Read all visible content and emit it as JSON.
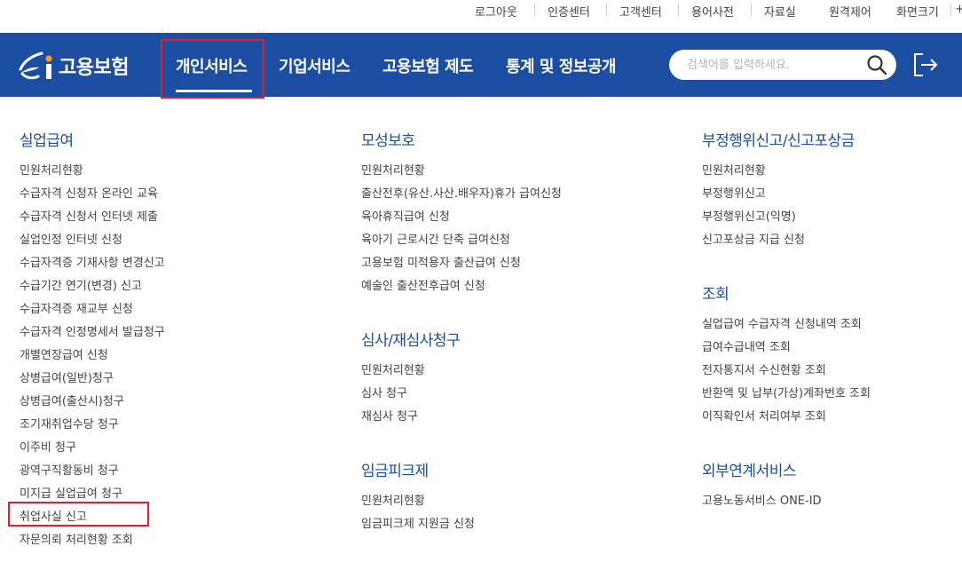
{
  "utility_links": [
    "로그아웃",
    "인증센터",
    "고객센터",
    "용어사전",
    "자료실",
    "원격제어",
    "화면크기"
  ],
  "utility_extra": "+",
  "logo": {
    "text": "고용보험"
  },
  "nav": {
    "items": [
      "개인서비스",
      "기업서비스",
      "고용보험 제도",
      "통계 및 정보공개"
    ]
  },
  "search": {
    "placeholder": "검색어를 입력하세요."
  },
  "icons": {
    "search": "search-icon",
    "logout": "logout-icon"
  },
  "colors": {
    "header_bg": "#1b4ea3",
    "section_title": "#1b4ea3",
    "highlight": "#e41e26"
  },
  "sections": {
    "unemployment": {
      "title": "실업급여",
      "items": [
        "민원처리현황",
        "수급자격 신청자 온라인 교육",
        "수급자격 신청서 인터넷 제출",
        "실업인정 인터넷 신청",
        "수급자격증 기재사항 변경신고",
        "수급기간 연기(변경) 신고",
        "수급자격증 재교부 신청",
        "수급자격 인정명세서 발급청구",
        "개별연장급여 신청",
        "상병급여(일반)청구",
        "상병급여(출산시)청구",
        "조기재취업수당 청구",
        "이주비 청구",
        "광역구직활동비 청구",
        "미지급 실업급여 청구",
        "취업사실 신고",
        "자문의뢰 처리현황 조회"
      ]
    },
    "maternity": {
      "title": "모성보호",
      "items": [
        "민원처리현황",
        "출산전후(유산.사산.배우자)휴가 급여신청",
        "육아휴직급여 신청",
        "육아기 근로시간 단축 급여신청",
        "고용보험 미적용자 출산급여 신청",
        "예술인 출산전후급여 신청"
      ]
    },
    "review": {
      "title": "심사/재심사청구",
      "items": [
        "민원처리현황",
        "심사 청구",
        "재심사 청구"
      ]
    },
    "wage_peak": {
      "title": "임금피크제",
      "items": [
        "민원처리현황",
        "임금피크제 지원금 신청"
      ]
    },
    "fraud": {
      "title": "부정행위신고/신고포상금",
      "items": [
        "민원처리현황",
        "부정행위신고",
        "부정행위신고(익명)",
        "신고포상금 지급 신청"
      ]
    },
    "inquiry": {
      "title": "조회",
      "items": [
        "실업급여 수급자격 신청내역 조회",
        "급여수급내역 조회",
        "전자통지서 수신현황 조회",
        "반환액 및 납부(가상)계좌번호 조회",
        "이직확인서 처리여부 조회"
      ]
    },
    "external": {
      "title": "외부연계서비스",
      "items": [
        "고용노동서비스 ONE-ID"
      ]
    }
  }
}
